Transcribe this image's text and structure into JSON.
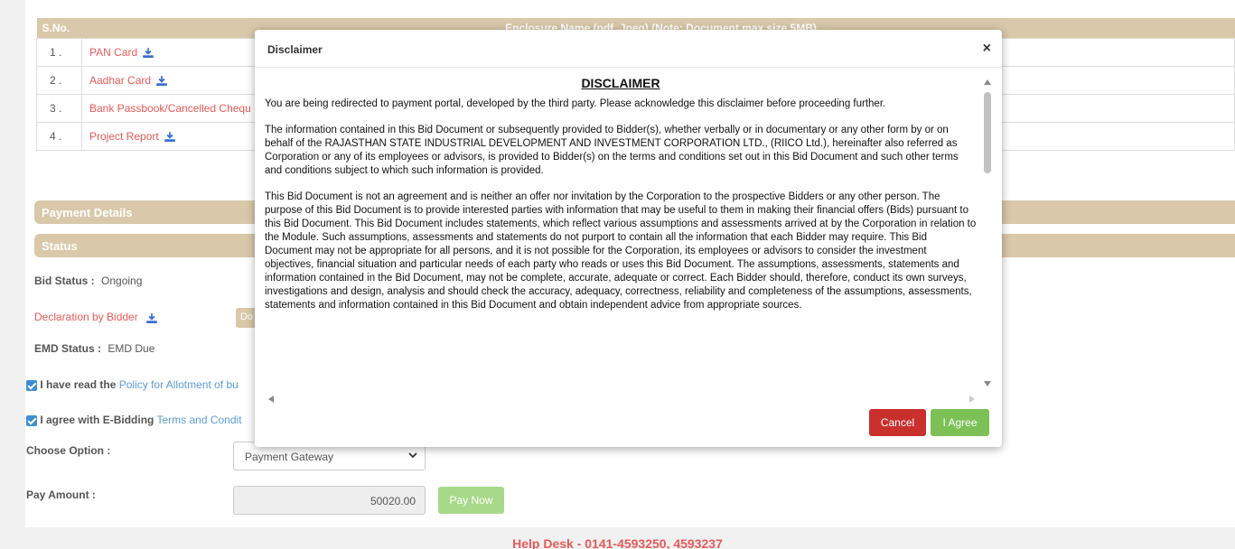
{
  "table": {
    "headers": [
      "S.No.",
      "Enclosure Name (pdf, Jpeg) (Note: Document max size 5MB)"
    ],
    "rows": [
      {
        "sn": "1 .",
        "name": "PAN Card"
      },
      {
        "sn": "2 .",
        "name": "Aadhar Card"
      },
      {
        "sn": "3 .",
        "name": "Bank Passbook/Cancelled Chequ"
      },
      {
        "sn": "4 .",
        "name": "Project Report"
      }
    ]
  },
  "sections": {
    "payment": "Payment Details",
    "status": "Status"
  },
  "status": {
    "bid_label": "Bid Status :",
    "bid_value": "Ongoing",
    "declaration": "Declaration by Bidder",
    "declaration_btn": "Do",
    "emd_label": "EMD Status :",
    "emd_value": "EMD Due"
  },
  "checks": {
    "policy_prefix": "I have read the",
    "policy_link": "Policy for Allotment of bu",
    "terms_prefix": "I agree with E-Bidding",
    "terms_link": "Terms and Condit"
  },
  "form": {
    "choose_label": "Choose Option :",
    "choose_value": "Payment Gateway",
    "pay_label": "Pay Amount :",
    "pay_value": "50020.00",
    "pay_button": "Pay Now"
  },
  "helpdesk": "Help Desk - 0141-4593250, 4593237",
  "modal": {
    "title": "Disclaimer",
    "close": "×",
    "heading": "DISCLAIMER",
    "p1": "You are being redirected to payment portal, developed by the third party. Please acknowledge this disclaimer before proceeding further.",
    "p2": "The information contained in this Bid Document or subsequently provided to Bidder(s), whether verbally or in documentary or any other form by or on behalf of the RAJASTHAN STATE INDUSTRIAL DEVELOPMENT AND INVESTMENT CORPORATION LTD., (RIICO Ltd.), hereinafter also referred as Corporation or any of its employees or advisors, is provided to Bidder(s) on the terms and conditions set out in this Bid Document and such other terms and conditions subject to which such information is provided.",
    "p3": "This Bid Document is not an agreement and is neither an offer nor invitation by the Corporation to the prospective Bidders or any other person. The purpose of this Bid Document is to provide interested parties with information that may be useful to them in making their financial offers (Bids) pursuant to this Bid Document. This Bid Document includes statements, which reflect various assumptions and assessments arrived at by the Corporation in relation to the Module. Such assumptions, assessments and statements do not purport to contain all the information that each Bidder may require. This Bid Document may not be appropriate for all persons, and it is not possible for the Corporation, its employees or advisors to consider the investment objectives, financial situation and particular needs of each party who reads or uses this Bid Document. The assumptions, assessments, statements and information contained in the Bid Document, may not be complete, accurate, adequate or correct. Each Bidder should, therefore, conduct its own surveys, investigations and design, analysis and should check the accuracy, adequacy, correctness, reliability and completeness of the assumptions, assessments, statements and information contained in this Bid Document and obtain independent advice from appropriate sources.",
    "cancel": "Cancel",
    "agree": "I Agree"
  },
  "colors": {
    "accent": "#d9c8a9",
    "link_red": "#e85a5a",
    "cancel": "#c9302c",
    "agree": "#7cc056"
  }
}
